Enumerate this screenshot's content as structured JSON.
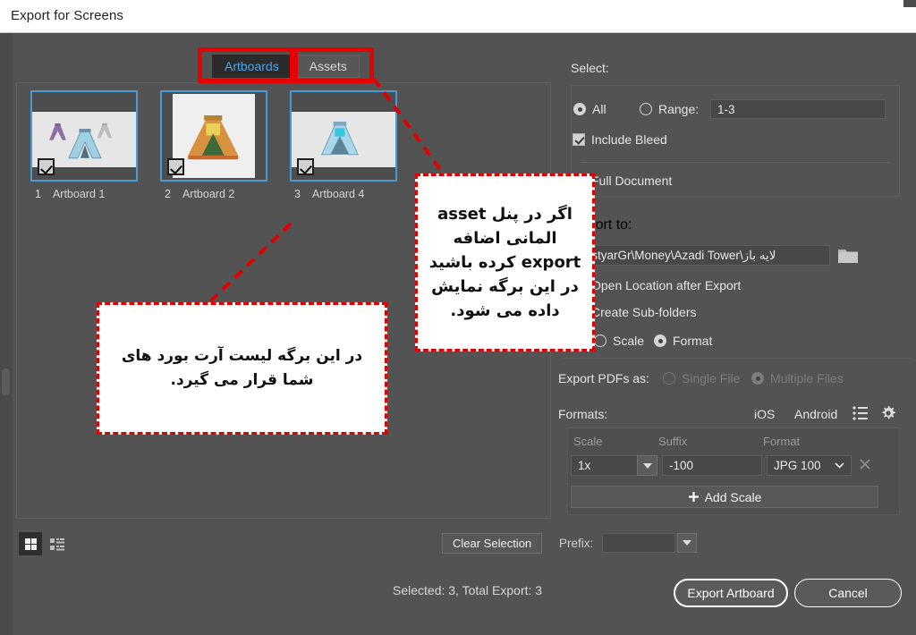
{
  "window": {
    "title": "Export for Screens"
  },
  "tabs": [
    {
      "label": "Artboards",
      "active": true
    },
    {
      "label": "Assets",
      "active": false
    }
  ],
  "artboards": [
    {
      "index": "1",
      "name": "Artboard 1",
      "checked": true,
      "orientation": "landscape"
    },
    {
      "index": "2",
      "name": "Artboard 2",
      "checked": true,
      "orientation": "portrait"
    },
    {
      "index": "3",
      "name": "Artboard 4",
      "checked": true,
      "orientation": "landscape"
    }
  ],
  "view_toggles": {
    "grid_icon": "grid-view-icon",
    "list_icon": "list-view-icon",
    "active": "grid"
  },
  "left_bottom": {
    "clear_selection_label": "Clear Selection",
    "prefix_label": "Prefix:",
    "prefix_value": "",
    "prefix_dropdown_icon": "chevron-down-icon"
  },
  "settings": {
    "select_label": "Select:",
    "all_label": "All",
    "all_selected": true,
    "range_label": "Range:",
    "range_selected": false,
    "range_value": "1-3",
    "include_bleed_label": "Include Bleed",
    "include_bleed_checked": true,
    "full_document_label": "Full Document",
    "full_document_checked": false,
    "export_to_label": "Export to:",
    "path_value": "DastyarGr\\Money\\Azadi Tower\\لایه باز",
    "folder_icon": "folder-icon",
    "open_location_label": "Open Location after Export",
    "open_location_checked": false,
    "create_subfolders_label": "Create Sub-folders",
    "create_subfolders_checked": false,
    "scale_label": "Scale",
    "scale_selected": false,
    "format_label": "Format",
    "format_selected": true,
    "export_pdfs_label": "Export PDFs as:",
    "single_file_label": "Single File",
    "single_file_selected": false,
    "multiple_files_label": "Multiple Files",
    "multiple_files_selected": true,
    "formats_label": "Formats:",
    "ios_label": "iOS",
    "android_label": "Android",
    "list_icon": "list-icon",
    "gear_icon": "gear-icon",
    "columns": {
      "scale": "Scale",
      "suffix": "Suffix",
      "format": "Format"
    },
    "scale_row": {
      "scale_value": "1x",
      "scale_dropdown_icon": "caret-down-icon",
      "suffix_value": "-100",
      "format_value": "JPG 100",
      "format_dropdown_icon": "chevron-down-icon",
      "remove_icon": "close-icon"
    },
    "add_scale_label": "Add Scale",
    "add_scale_icon": "plus-icon"
  },
  "footer": {
    "status": "Selected: 3, Total Export: 3",
    "export_button": "Export Artboard",
    "cancel_button": "Cancel"
  },
  "annotations": {
    "callout_assets": "اگر در پنل asset المانی اضافه  export کرده باشید در این برگه نمایش داده می شود.",
    "callout_artboards": "در این برگه لیست آرت بورد های شما قرار می گیرد.",
    "highlight_color": "#e60000",
    "callout_border_color": "#e00000"
  }
}
